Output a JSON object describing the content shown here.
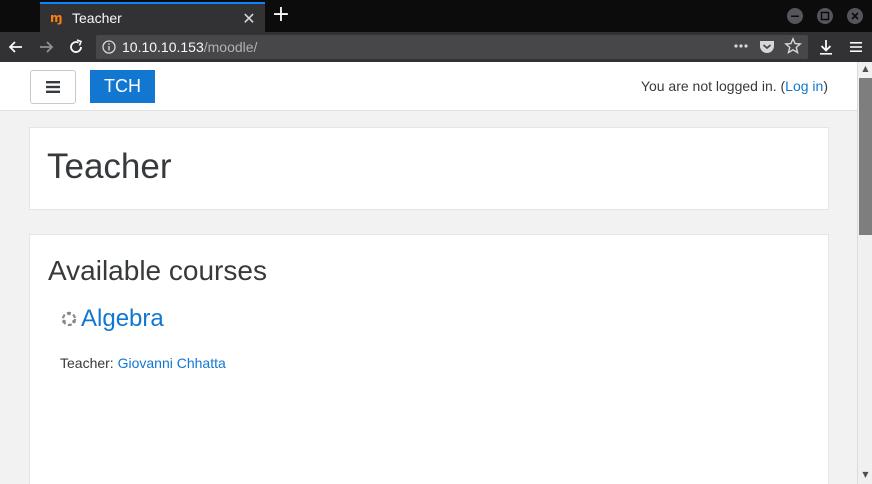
{
  "browser": {
    "tab_title": "Teacher",
    "tab_favicon": "moodle-m-icon",
    "new_tab_label": "+",
    "url_host": "10.10.10.153",
    "url_path": "/moodle/"
  },
  "header": {
    "brand": "TCH",
    "login_prefix": "You are not logged in. (",
    "login_link": "Log in",
    "login_suffix": ")"
  },
  "page": {
    "title": "Teacher"
  },
  "courses": {
    "heading": "Available courses",
    "items": [
      {
        "name": "Algebra",
        "teacher_label": "Teacher: ",
        "teacher_name": "Giovanni Chhatta"
      }
    ]
  },
  "colors": {
    "brand": "#1177d1",
    "link": "#1177d1",
    "tab_accent": "#0a84ff",
    "favicon": "#f98012"
  }
}
